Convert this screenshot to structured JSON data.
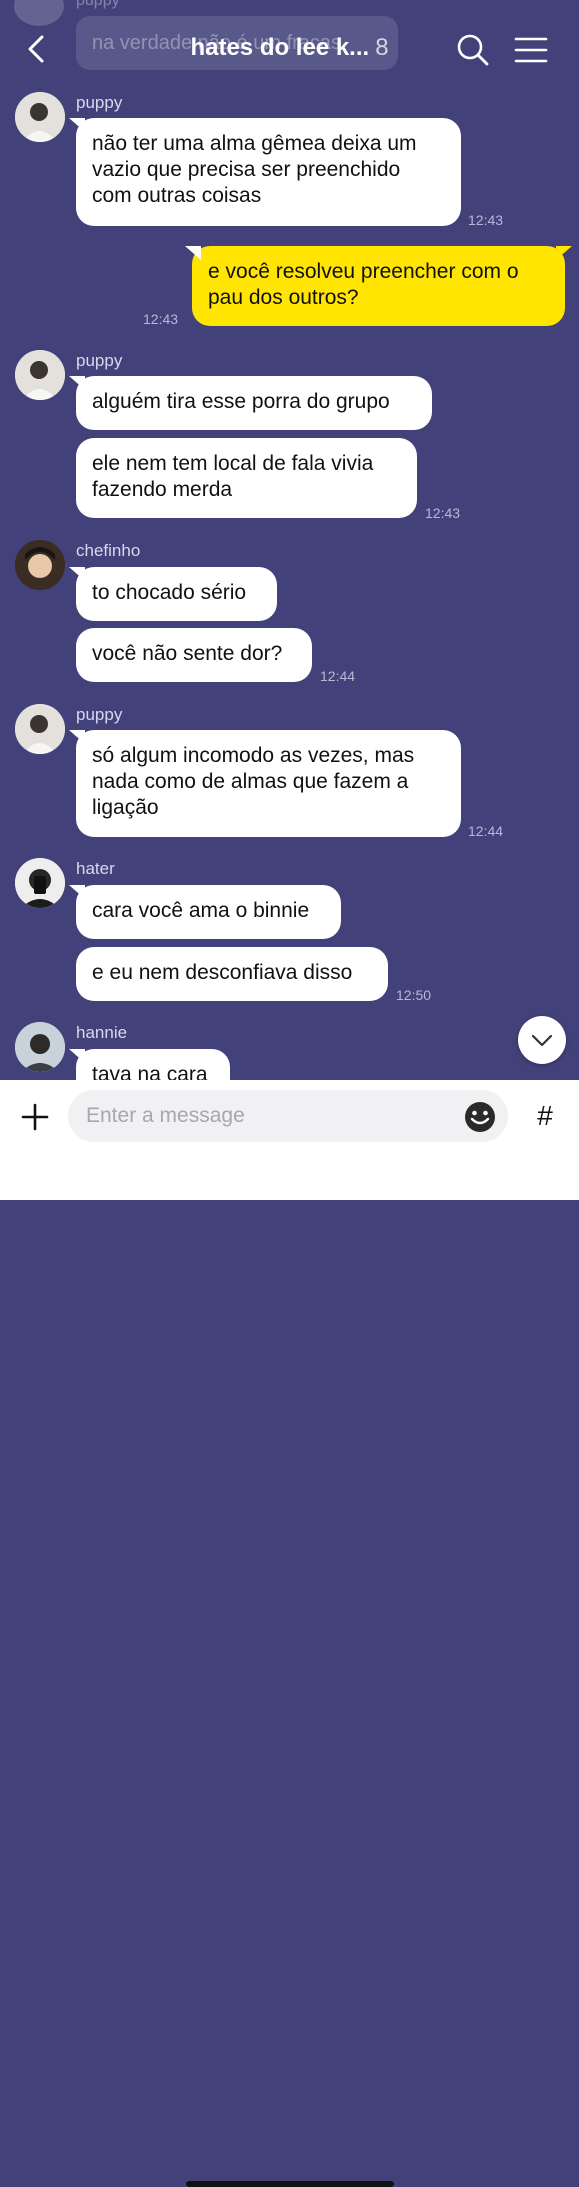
{
  "header": {
    "title": "hates do lee k...",
    "member_count": "8",
    "back_icon": "chevron-left-icon",
    "search_icon": "search-icon",
    "menu_icon": "hamburger-menu-icon"
  },
  "ghost": {
    "name": "puppy",
    "text": "na verdade não é um fracas"
  },
  "messages": [
    {
      "sender": "puppy",
      "text1": "não ter uma alma gêmea deixa um",
      "text2": "vazio que precisa ser preenchido",
      "text3": "com outras coisas",
      "time": "12:43"
    },
    {
      "sender": "me",
      "text1": "e você resolveu preencher com o",
      "text2": "pau dos outros?",
      "time": "12:43"
    },
    {
      "sender": "puppy",
      "text1": "alguém tira esse porra do grupo",
      "text2a": "ele nem tem local de fala vivia",
      "text2b": "fazendo merda",
      "time": "12:43"
    },
    {
      "sender": "chefinho",
      "text1": "to chocado sério",
      "text2": "você não sente dor?",
      "time": "12:44"
    },
    {
      "sender": "puppy",
      "text1": "só algum incomodo as vezes, mas",
      "text2": "nada como de almas que fazem a",
      "text3": "ligação",
      "time": "12:44"
    },
    {
      "sender": "hater",
      "text1": "cara você ama o binnie",
      "text2": "e eu nem desconfiava disso",
      "time": "12:50"
    },
    {
      "sender": "hannie",
      "text1": "tava na cara"
    }
  ],
  "composer": {
    "placeholder": "Enter a message",
    "plus_icon": "plus-icon",
    "emoji_icon": "smiley-icon",
    "hash_label": "#"
  }
}
